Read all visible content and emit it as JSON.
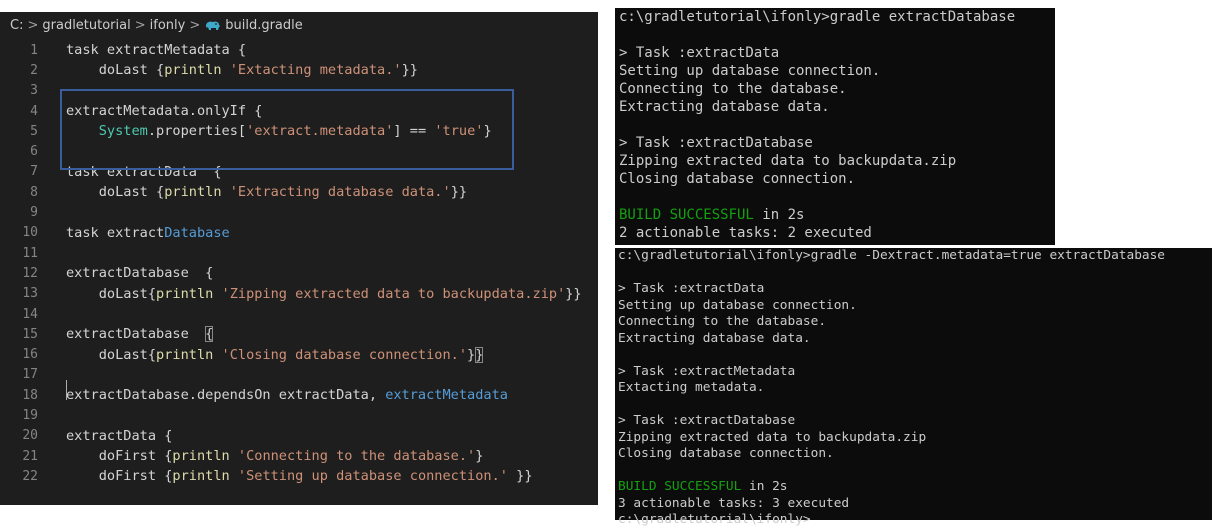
{
  "editor": {
    "breadcrumb": {
      "root": "C:",
      "separator": ">",
      "folder1": "gradletutorial",
      "folder2": "ifonly",
      "file": "build.gradle",
      "file_icon": "gradle-elephant-icon"
    },
    "lines": [
      {
        "n": "1",
        "parts": [
          {
            "t": "task extractMetadata {",
            "c": "plain"
          }
        ]
      },
      {
        "n": "2",
        "parts": [
          {
            "t": "    doLast {",
            "c": "plain"
          },
          {
            "t": "println",
            "c": "fn"
          },
          {
            "t": " ",
            "c": "plain"
          },
          {
            "t": "'Extacting metadata.'",
            "c": "str"
          },
          {
            "t": "}}",
            "c": "plain"
          }
        ]
      },
      {
        "n": "3",
        "parts": []
      },
      {
        "n": "4",
        "parts": [
          {
            "t": "extractMetadata.onlyIf {",
            "c": "plain"
          }
        ]
      },
      {
        "n": "5",
        "parts": [
          {
            "t": "    ",
            "c": "plain"
          },
          {
            "t": "System",
            "c": "cls"
          },
          {
            "t": ".properties[",
            "c": "plain"
          },
          {
            "t": "'extract.metadata'",
            "c": "str"
          },
          {
            "t": "] == ",
            "c": "plain"
          },
          {
            "t": "'true'",
            "c": "str"
          },
          {
            "t": "}",
            "c": "plain"
          }
        ]
      },
      {
        "n": "6",
        "parts": []
      },
      {
        "n": "7",
        "parts": [
          {
            "t": "task extractData  {",
            "c": "plain"
          }
        ]
      },
      {
        "n": "8",
        "parts": [
          {
            "t": "    doLast {",
            "c": "plain"
          },
          {
            "t": "println",
            "c": "fn"
          },
          {
            "t": " ",
            "c": "plain"
          },
          {
            "t": "'Extracting database data.'",
            "c": "str"
          },
          {
            "t": "}}",
            "c": "plain"
          }
        ]
      },
      {
        "n": "9",
        "parts": []
      },
      {
        "n": "10",
        "parts": [
          {
            "t": "task extract",
            "c": "plain"
          },
          {
            "t": "Database",
            "c": "kw"
          }
        ]
      },
      {
        "n": "11",
        "parts": []
      },
      {
        "n": "12",
        "parts": [
          {
            "t": "extractDatabase  {",
            "c": "plain"
          }
        ]
      },
      {
        "n": "13",
        "parts": [
          {
            "t": "    doLast{",
            "c": "plain"
          },
          {
            "t": "println",
            "c": "fn"
          },
          {
            "t": " ",
            "c": "plain"
          },
          {
            "t": "'Zipping extracted data to backupdata.zip'",
            "c": "str"
          },
          {
            "t": "}}",
            "c": "plain"
          }
        ]
      },
      {
        "n": "14",
        "parts": []
      },
      {
        "n": "15",
        "parts": [
          {
            "t": "extractDatabase  ",
            "c": "plain"
          },
          {
            "t": "{",
            "c": "plain",
            "box": true
          }
        ]
      },
      {
        "n": "16",
        "parts": [
          {
            "t": "    doLast{",
            "c": "plain"
          },
          {
            "t": "println",
            "c": "fn"
          },
          {
            "t": " ",
            "c": "plain"
          },
          {
            "t": "'Closing database connection.'",
            "c": "str"
          },
          {
            "t": "}",
            "c": "plain"
          },
          {
            "t": "}",
            "c": "plain",
            "box": true
          }
        ]
      },
      {
        "n": "17",
        "parts": []
      },
      {
        "n": "18",
        "parts": [
          {
            "t": "extractDatabase.dependsOn extractData, ",
            "c": "plain"
          },
          {
            "t": "extractMetadata",
            "c": "kw"
          }
        ]
      },
      {
        "n": "19",
        "parts": []
      },
      {
        "n": "20",
        "parts": [
          {
            "t": "extractData {",
            "c": "plain"
          }
        ]
      },
      {
        "n": "21",
        "parts": [
          {
            "t": "    doFirst {",
            "c": "plain"
          },
          {
            "t": "println",
            "c": "fn"
          },
          {
            "t": " ",
            "c": "plain"
          },
          {
            "t": "'Connecting to the database.'",
            "c": "str"
          },
          {
            "t": "}",
            "c": "plain"
          }
        ]
      },
      {
        "n": "22",
        "parts": [
          {
            "t": "    doFirst {",
            "c": "plain"
          },
          {
            "t": "println",
            "c": "fn"
          },
          {
            "t": " ",
            "c": "plain"
          },
          {
            "t": "'Setting up database connection.'",
            "c": "str"
          },
          {
            "t": " }}",
            "c": "plain"
          }
        ]
      }
    ]
  },
  "terminal1": {
    "lines": [
      {
        "t": "c:\\gradletutorial\\ifonly>gradle extractDatabase"
      },
      {
        "t": ""
      },
      {
        "t": "> Task :extractData"
      },
      {
        "t": "Setting up database connection."
      },
      {
        "t": "Connecting to the database."
      },
      {
        "t": "Extracting database data."
      },
      {
        "t": ""
      },
      {
        "t": "> Task :extractDatabase"
      },
      {
        "t": "Zipping extracted data to backupdata.zip"
      },
      {
        "t": "Closing database connection."
      },
      {
        "t": ""
      },
      {
        "t": "BUILD SUCCESSFUL",
        "g": true,
        "rest": " in 2s"
      },
      {
        "t": "2 actionable tasks: 2 executed"
      }
    ]
  },
  "terminal2": {
    "lines": [
      {
        "t": "c:\\gradletutorial\\ifonly>gradle -Dextract.metadata=true extractDatabase"
      },
      {
        "t": ""
      },
      {
        "t": "> Task :extractData"
      },
      {
        "t": "Setting up database connection."
      },
      {
        "t": "Connecting to the database."
      },
      {
        "t": "Extracting database data."
      },
      {
        "t": ""
      },
      {
        "t": "> Task :extractMetadata"
      },
      {
        "t": "Extacting metadata."
      },
      {
        "t": ""
      },
      {
        "t": "> Task :extractDatabase"
      },
      {
        "t": "Zipping extracted data to backupdata.zip"
      },
      {
        "t": "Closing database connection."
      },
      {
        "t": ""
      },
      {
        "t": "BUILD SUCCESSFUL",
        "g": true,
        "rest": " in 2s"
      },
      {
        "t": "3 actionable tasks: 3 executed"
      },
      {
        "t": "c:\\gradletutorial\\ifonly>"
      }
    ]
  }
}
